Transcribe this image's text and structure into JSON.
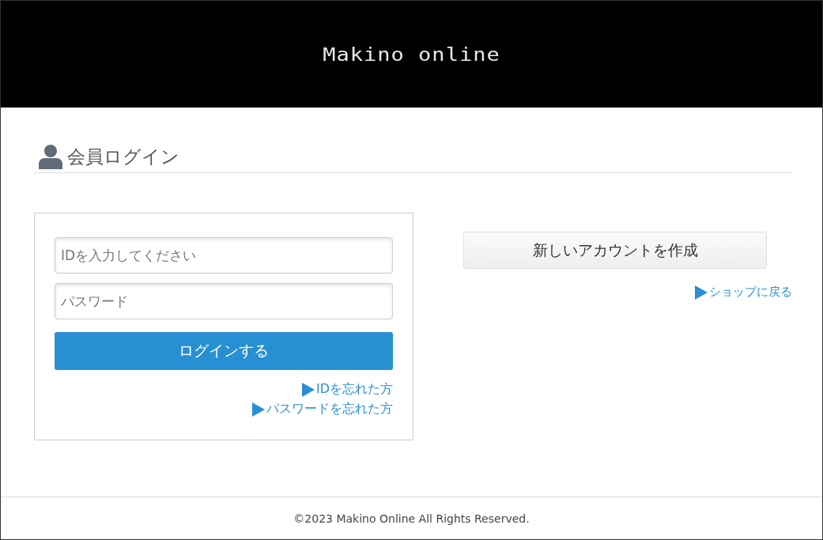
{
  "header": {
    "logo": "Makino online"
  },
  "heading": {
    "title": "会員ログイン"
  },
  "login_form": {
    "fields": [
      {
        "placeholder": "IDを入力してください"
      },
      {
        "placeholder": "パスワード"
      }
    ],
    "submit": "ログインする",
    "links": [
      "IDを忘れた方",
      "パスワードを忘れた方"
    ]
  },
  "register": {
    "button": "新しいアカウントを作成",
    "link": "ショップに戻る"
  },
  "footer": {
    "copyright": "©2023 Makino Online All Rights Reserved."
  }
}
